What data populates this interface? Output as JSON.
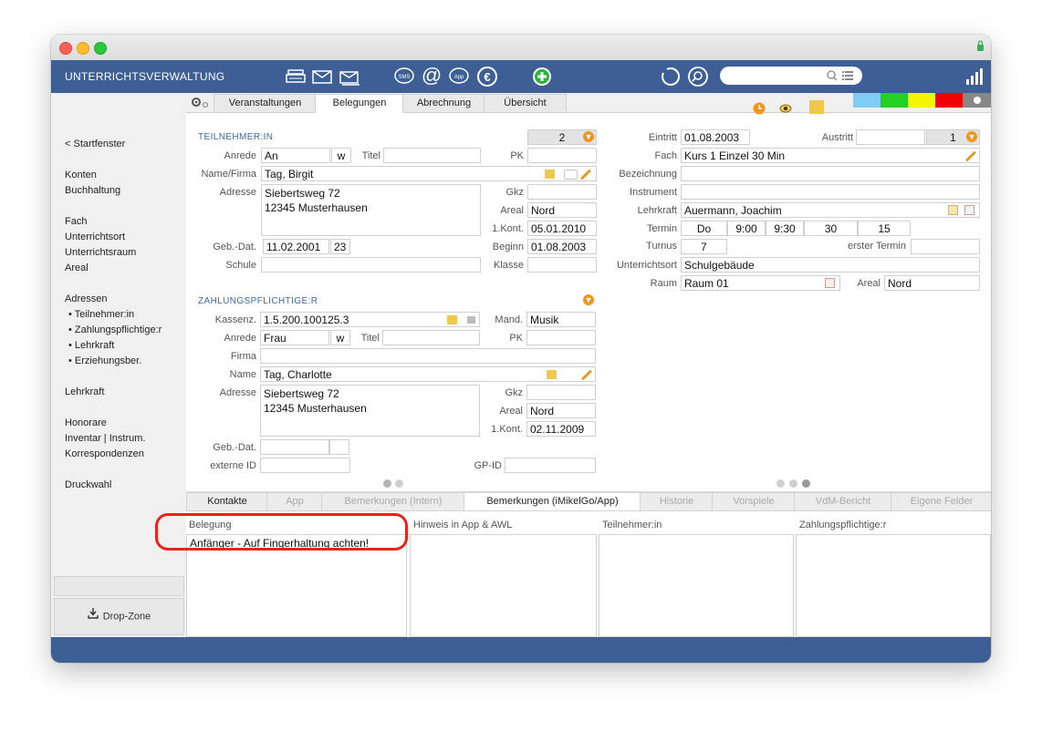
{
  "header": {
    "app_title": "UNTERRICHTSVERWALTUNG",
    "sms_label": "SMS",
    "app_label": "App"
  },
  "sidebar": {
    "back": "< Startfenster",
    "items": [
      "Konten",
      "Buchhaltung",
      "Fach",
      "Unterrichtsort",
      "Unterrichtsraum",
      "Areal",
      "Adressen"
    ],
    "sub_items": [
      "• Teilnehmer:in",
      "• Zahlungspflichtige:r",
      "• Lehrkraft",
      "• Erziehungsber."
    ],
    "items2": [
      "Lehrkraft",
      "Honorare",
      "Inventar | Instrum.",
      "Korrespondenzen",
      "Druckwahl"
    ],
    "dropzone": "Drop-Zone"
  },
  "tabs": [
    "Veranstaltungen",
    "Belegungen",
    "Abrechnung",
    "Übersicht"
  ],
  "color_swatches": [
    "#7fcdf5",
    "#23d123",
    "#f5f500",
    "#f00000"
  ],
  "teilnehmer": {
    "section": "TEILNEHMER:IN",
    "count": "2",
    "labels": {
      "anrede": "Anrede",
      "titel": "Titel",
      "pk": "PK",
      "name": "Name/Firma",
      "adresse": "Adresse",
      "gkz": "Gkz",
      "areal": "Areal",
      "kont": "1.Kont.",
      "geb": "Geb.-Dat.",
      "beginn": "Beginn",
      "schule": "Schule",
      "klasse": "Klasse"
    },
    "anrede": "An",
    "anrede_w": "w",
    "name": "Tag, Birgit",
    "adresse": "Siebertsweg 72\n12345 Musterhausen",
    "areal": "Nord",
    "kont": "05.01.2010",
    "geb": "11.02.2001",
    "alter": "23",
    "beginn": "01.08.2003"
  },
  "zahler": {
    "section": "ZAHLUNGSPFLICHTIGE:R",
    "labels": {
      "kassenz": "Kassenz.",
      "mand": "Mand.",
      "anrede": "Anrede",
      "titel": "Titel",
      "pk": "PK",
      "firma": "Firma",
      "name": "Name",
      "adresse": "Adresse",
      "gkz": "Gkz",
      "areal": "Areal",
      "kont": "1.Kont.",
      "geb": "Geb.-Dat.",
      "extid": "externe ID",
      "gpid": "GP-ID"
    },
    "kassenz": "1.5.200.100125.3",
    "mand": "Musik",
    "anrede": "Frau",
    "anrede_w": "w",
    "name": "Tag, Charlotte",
    "adresse": "Siebertsweg 72\n12345 Musterhausen",
    "areal": "Nord",
    "kont": "02.11.2009"
  },
  "belegung": {
    "labels": {
      "eintritt": "Eintritt",
      "austritt": "Austritt",
      "fach": "Fach",
      "bezeichnung": "Bezeichnung",
      "instrument": "Instrument",
      "lehrkraft": "Lehrkraft",
      "termin": "Termin",
      "turnus": "Turnus",
      "erster": "erster Termin",
      "uort": "Unterrichtsort",
      "raum": "Raum",
      "areal": "Areal"
    },
    "eintritt": "01.08.2003",
    "austritt_nr": "1",
    "fach": "Kurs 1 Einzel 30 Min",
    "lehrkraft": "Auermann, Joachim",
    "termin": [
      "Do",
      "9:00",
      "9:30",
      "30",
      "15"
    ],
    "turnus": "7",
    "uort": "Schulgebäude",
    "raum": "Raum 01",
    "areal": "Nord"
  },
  "bottom_tabs": [
    "Kontakte",
    "App",
    "Bemerkungen (Intern)",
    "Bemerkungen (iMikelGo/App)",
    "Historie",
    "Vorspiele",
    "VdM-Bericht",
    "Eigene Felder"
  ],
  "panes": {
    "belegung_label": "Belegung",
    "belegung_text": "Anfänger - Auf Fingerhaltung achten!",
    "hinweis_label": "Hinweis in App & AWL",
    "teilnehmer_label": "Teilnehmer:in",
    "zahler_label": "Zahlungspflichtige:r"
  },
  "highlight_color": "#e8231a"
}
